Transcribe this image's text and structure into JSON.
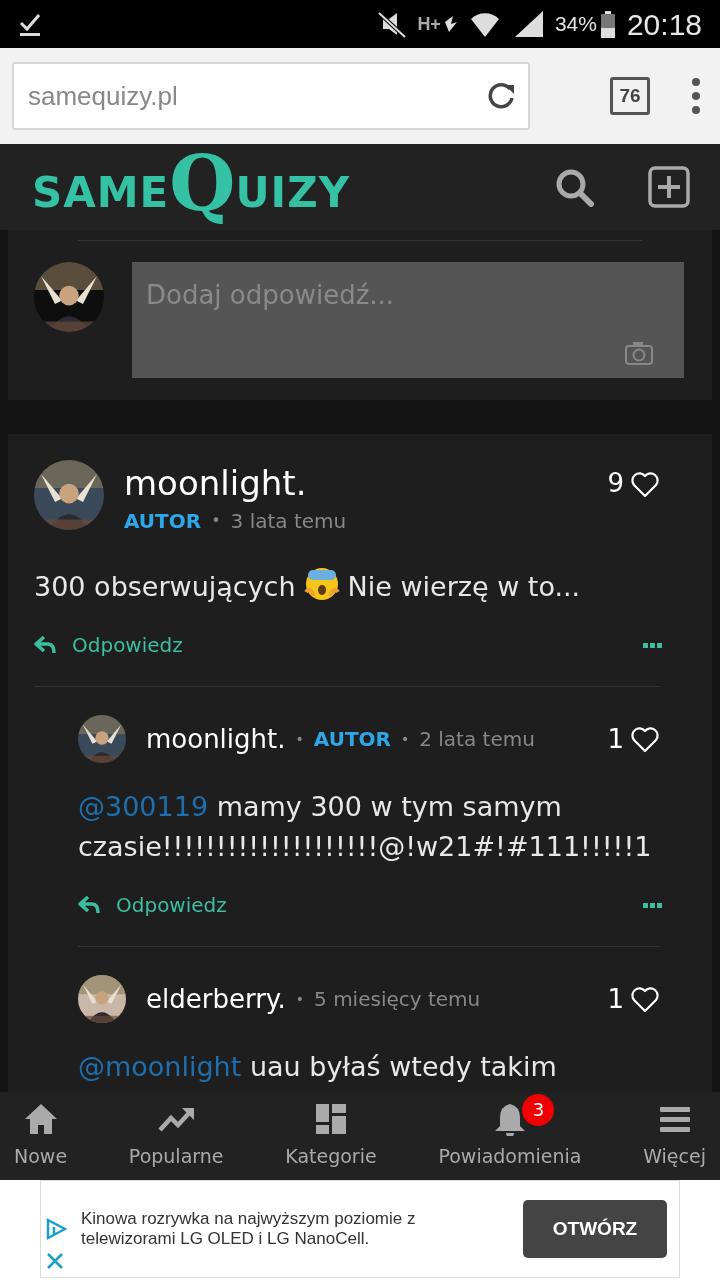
{
  "status_bar": {
    "network_type": "H+",
    "battery": "34%",
    "time": "20:18"
  },
  "browser": {
    "url": "samequizy.pl",
    "tab_count": "76"
  },
  "header": {
    "logo_parts": [
      "SAME",
      "Q",
      "UIZY"
    ]
  },
  "reply_box": {
    "placeholder": "Dodaj odpowiedź..."
  },
  "comments": [
    {
      "author": "moonlight.",
      "badge": "AUTOR",
      "separators": [
        "•"
      ],
      "time": "3 lata temu",
      "likes": "9",
      "segments": [
        {
          "kind": "text",
          "text": "300 obserwujących"
        },
        {
          "kind": "emoji"
        },
        {
          "kind": "text",
          "text": "Nie wierzę w to..."
        }
      ],
      "reply": "Odpowiedz",
      "children": [
        {
          "author": "moonlight.",
          "badge": "AUTOR",
          "separators": [
            "•",
            "•"
          ],
          "time": "2 lata temu",
          "likes": "1",
          "segments": [
            {
              "kind": "mention",
              "text": "@300119"
            },
            {
              "kind": "text",
              "text": "mamy 300 w tym samym czasie!!!!!!!!!!!!!!!!!!!!@!w21#!#111!!!!!1"
            }
          ],
          "reply": "Odpowiedz"
        },
        {
          "author": "elderberry.",
          "separators": [
            "•"
          ],
          "time": "5 miesięcy temu",
          "likes": "1",
          "segments": [
            {
              "kind": "mention",
              "text": "@moonlight"
            },
            {
              "kind": "text",
              "text": "uau byłaś wtedy takim"
            }
          ]
        }
      ]
    }
  ],
  "bottom_nav": [
    {
      "label": "Nowe",
      "kind": "home"
    },
    {
      "label": "Popularne",
      "kind": "trend"
    },
    {
      "label": "Kategorie",
      "kind": "grid"
    },
    {
      "label": "Powiadomienia",
      "kind": "bell",
      "badge": "3"
    },
    {
      "label": "Więcej",
      "kind": "menu"
    }
  ],
  "ad": {
    "text": "Kinowa rozrywka na najwyższym poziomie z telewizorami LG OLED i LG NanoCell.",
    "button": "OTWÓRZ"
  }
}
